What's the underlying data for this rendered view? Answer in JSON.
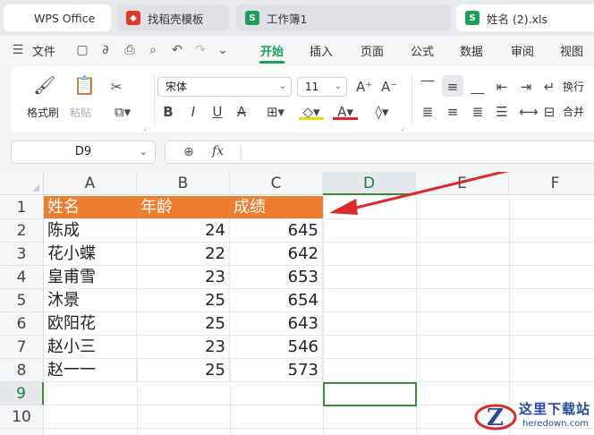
{
  "tabs": [
    {
      "label": "WPS Office",
      "icon": "wps-logo-icon"
    },
    {
      "label": "找稻壳模板",
      "icon": "docer-icon"
    },
    {
      "label": "工作簿1",
      "icon": "sheet-icon"
    },
    {
      "label": "姓名 (2).xls",
      "icon": "sheet-icon"
    }
  ],
  "menu": {
    "file": "文件",
    "items": [
      "开始",
      "插入",
      "页面",
      "公式",
      "数据",
      "审阅",
      "视图"
    ],
    "active": "开始"
  },
  "ribbon": {
    "format_painter": "格式刷",
    "paste": "粘贴",
    "font_name": "宋体",
    "font_size": "11",
    "wrap_text": "换行",
    "merge": "合并",
    "colors": {
      "highlight": "#f5d800",
      "font": "#e0262c"
    }
  },
  "formula_bar": {
    "name_box": "D9",
    "fx_label": "fx",
    "formula": ""
  },
  "sheet": {
    "columns": [
      "A",
      "B",
      "C",
      "D",
      "E",
      "F"
    ],
    "rows": [
      "1",
      "2",
      "3",
      "4",
      "5",
      "6",
      "7",
      "8",
      "9",
      "10"
    ],
    "header_row": [
      "姓名",
      "年龄",
      "成绩"
    ],
    "data": [
      [
        "陈成",
        "24",
        "645"
      ],
      [
        "花小蝶",
        "22",
        "642"
      ],
      [
        "皇甫雪",
        "23",
        "653"
      ],
      [
        "沐景",
        "25",
        "654"
      ],
      [
        "欧阳花",
        "25",
        "643"
      ],
      [
        "赵小三",
        "23",
        "546"
      ],
      [
        "赵一一",
        "25",
        "573"
      ]
    ],
    "selected_cell": "D9",
    "header_fill": "#ed7d31",
    "selection_color": "#3c8a3c"
  },
  "annotation_arrow_color": "#d92b2b",
  "watermark": {
    "title": "这里下载站",
    "sub": "heredown.com"
  }
}
